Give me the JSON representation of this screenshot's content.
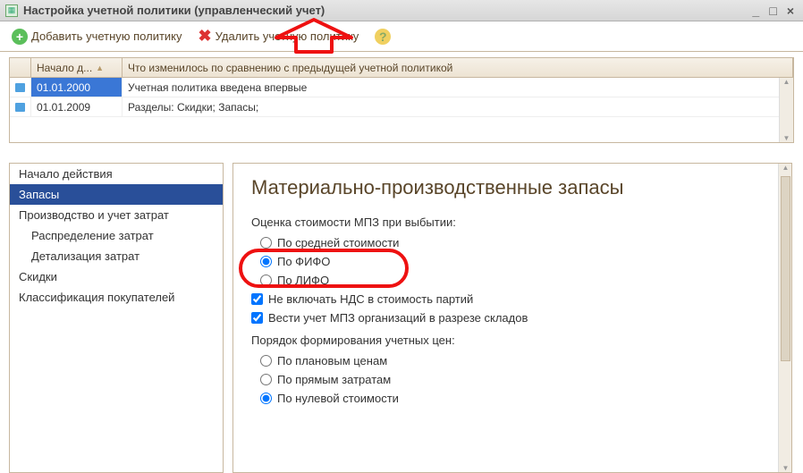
{
  "window": {
    "title": "Настройка учетной политики (управленческий учет)"
  },
  "toolbar": {
    "add_label": "Добавить учетную политику",
    "delete_label": "Удалить учетную политику"
  },
  "table": {
    "headers": {
      "col1": "",
      "col2": "Начало д...",
      "col3": "Что изменилось по сравнению с предыдущей учетной политикой"
    },
    "rows": [
      {
        "date": "01.01.2000",
        "change": "Учетная политика введена впервые",
        "selected": true
      },
      {
        "date": "01.01.2009",
        "change": "Разделы: Скидки; Запасы;",
        "selected": false
      }
    ]
  },
  "nav": {
    "items": [
      {
        "label": "Начало действия",
        "lv": 1
      },
      {
        "label": "Запасы",
        "lv": 1,
        "selected": true
      },
      {
        "label": "Производство и учет затрат",
        "lv": 1
      },
      {
        "label": "Распределение затрат",
        "lv": 2
      },
      {
        "label": "Детализация затрат",
        "lv": 2
      },
      {
        "label": "Скидки",
        "lv": 1
      },
      {
        "label": "Классификация покупателей",
        "lv": 1
      }
    ]
  },
  "content": {
    "heading": "Материально-производственные запасы",
    "group1_label": "Оценка стоимости МПЗ при выбытии:",
    "options1": [
      {
        "label": "По средней стоимости",
        "checked": false
      },
      {
        "label": "По ФИФО",
        "checked": true
      },
      {
        "label": "По ЛИФО",
        "checked": false
      }
    ],
    "check1": {
      "label": "Не включать НДС в стоимость партий",
      "checked": true
    },
    "check2": {
      "label": "Вести учет МПЗ организаций в разрезе складов",
      "checked": true
    },
    "group2_label": "Порядок формирования учетных цен:",
    "options2": [
      {
        "label": "По плановым ценам",
        "checked": false
      },
      {
        "label": "По прямым затратам",
        "checked": false
      },
      {
        "label": "По нулевой стоимости",
        "checked": true
      }
    ]
  }
}
